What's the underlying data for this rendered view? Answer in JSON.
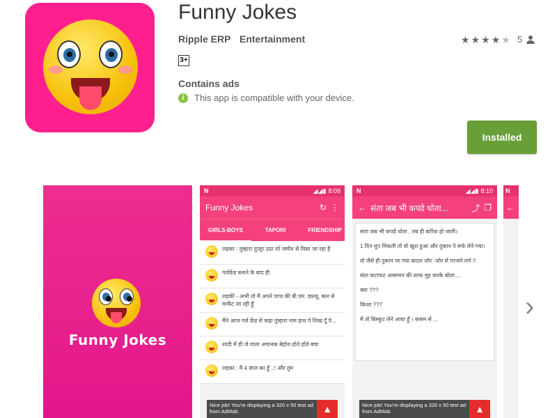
{
  "app": {
    "title": "Funny Jokes",
    "developer": "Ripple ERP",
    "category": "Entertainment",
    "rating_stars": 4,
    "rating_count": "5",
    "age_badge": "3+",
    "contains_ads": "Contains ads",
    "compatibility": "This app is compatible with your device.",
    "install_label": "Installed"
  },
  "colors": {
    "brand": "#ff1f8e",
    "install": "#689f38",
    "toolbar": "#f5417b"
  },
  "screenshots": {
    "splash": {
      "title": "Funny Jokes"
    },
    "list_screen": {
      "status_time": "8:09",
      "status_n": "N",
      "toolbar_title": "Funny Jokes",
      "tabs": [
        "GIRLS-BOYS",
        "TAPORI",
        "FRIENDSHIP"
      ],
      "rows": [
        "लड़का : तुम्हारा दुपट्टा उठा लो जमीन से घिसा जा रहा है",
        "गर्लफ्रेंड बनाने के बाद ही",
        "लड़की - अभी तो मैं अपने पापा की बी.एम. डब्ल्यू, कार से मार्केट जा रही हूँ",
        "मैंने आज गर्ल फ्रेंड से कहा तुम्हारा नाम हाथ पे लिख दूँ पे...",
        "शादी में डी जे वाला अचानक बेहोश होते होते बचा",
        "लड़का : मै 4 साल का हूँ ..! और तुम"
      ],
      "ad_text": "Nice job! You're displaying a 320 x 50 test ad from AdMob."
    },
    "detail_screen": {
      "status_time": "8:10",
      "status_n": "N",
      "toolbar_title": "संता जब भी कपडे धोता...",
      "paragraphs": [
        "संता जब भी कपडे धोता , तब ही बारिश हो जाती।",
        "1 दिन धूप निकली तो वो खुश हुआ और दुकान पे सर्फ लेने गया।",
        "वो जैसे ही दुकान पर गया बादल जोर -जोर से गरजने लगे !!",
        "संता फटाफट आसमान की तरफ मुह करके बोला....",
        "क्या ???",
        "किधर ???",
        "मै तो बिस्कुट लेने आया हूँ । कसम से ..."
      ],
      "ad_text": "Nice job! You're displaying a 320 x 50 test ad from AdMob."
    },
    "next_arrow": "›"
  }
}
